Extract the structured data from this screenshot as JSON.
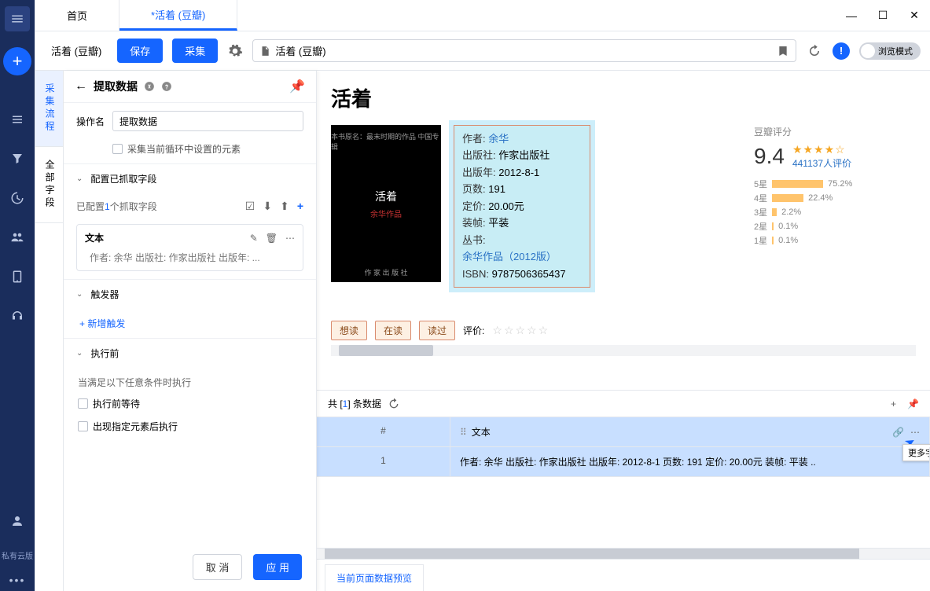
{
  "tabs": {
    "home": "首页",
    "active": "*活着 (豆瓣)"
  },
  "toolbar": {
    "task_name": "活着 (豆瓣)",
    "save": "保存",
    "collect": "采集",
    "url_display": "活着 (豆瓣)",
    "browse_mode": "浏览模式"
  },
  "side_tabs": {
    "flow": "采集流程",
    "fields": "全部字段"
  },
  "panel": {
    "title": "提取数据",
    "op_name_label": "操作名",
    "op_name_value": "提取数据",
    "loop_check": "采集当前循环中设置的元素",
    "section_config": "配置已抓取字段",
    "configured_pre": "已配置",
    "configured_num": "1",
    "configured_suf": "个抓取字段",
    "field": {
      "name": "文本",
      "preview": "作者: 余华 出版社: 作家出版社 出版年: ..."
    },
    "section_trigger": "触发器",
    "add_trigger": "+ 新增触发",
    "section_before": "执行前",
    "cond_text": "当满足以下任意条件时执行",
    "wait_check": "执行前等待",
    "elem_check": "出现指定元素后执行",
    "cancel": "取 消",
    "apply": "应 用"
  },
  "book": {
    "title": "活着",
    "cover_title": "活着",
    "cover_author": "余华作品",
    "meta": {
      "author_l": "作者:",
      "author_v": "余华",
      "pub_l": "出版社:",
      "pub_v": "作家出版社",
      "year_l": "出版年:",
      "year_v": "2012-8-1",
      "pages_l": "页数:",
      "pages_v": "191",
      "price_l": "定价:",
      "price_v": "20.00元",
      "bind_l": "装帧:",
      "bind_v": "平装",
      "series_l": "丛书:",
      "series_v": "余华作品（2012版）",
      "isbn_l": "ISBN:",
      "isbn_v": "9787506365437"
    },
    "rating": {
      "title": "豆瓣评分",
      "score": "9.4",
      "stars": "★★★★☆",
      "count": "441137人评价",
      "bars": [
        {
          "label": "5星",
          "pct": "75.2%",
          "w": 65
        },
        {
          "label": "4星",
          "pct": "22.4%",
          "w": 40
        },
        {
          "label": "3星",
          "pct": "2.2%",
          "w": 6
        },
        {
          "label": "2星",
          "pct": "0.1%",
          "w": 2
        },
        {
          "label": "1星",
          "pct": "0.1%",
          "w": 2
        }
      ]
    },
    "read": {
      "want": "想读",
      "reading": "在读",
      "read": "读过",
      "rate_label": "评价:"
    }
  },
  "data_preview": {
    "total_pre": "共 [",
    "total_num": "1",
    "total_suf": "] 条数据",
    "col_idx": "#",
    "col_name": "文本",
    "row_idx": "1",
    "row_val": "作者: 余华 出版社: 作家出版社 出版年: 2012-8-1 页数: 191 定价: 20.00元 装帧: 平装 ..",
    "tooltip": "更多字段",
    "tab": "当前页面数据预览"
  },
  "nav": {
    "cloud": "私有云版"
  }
}
